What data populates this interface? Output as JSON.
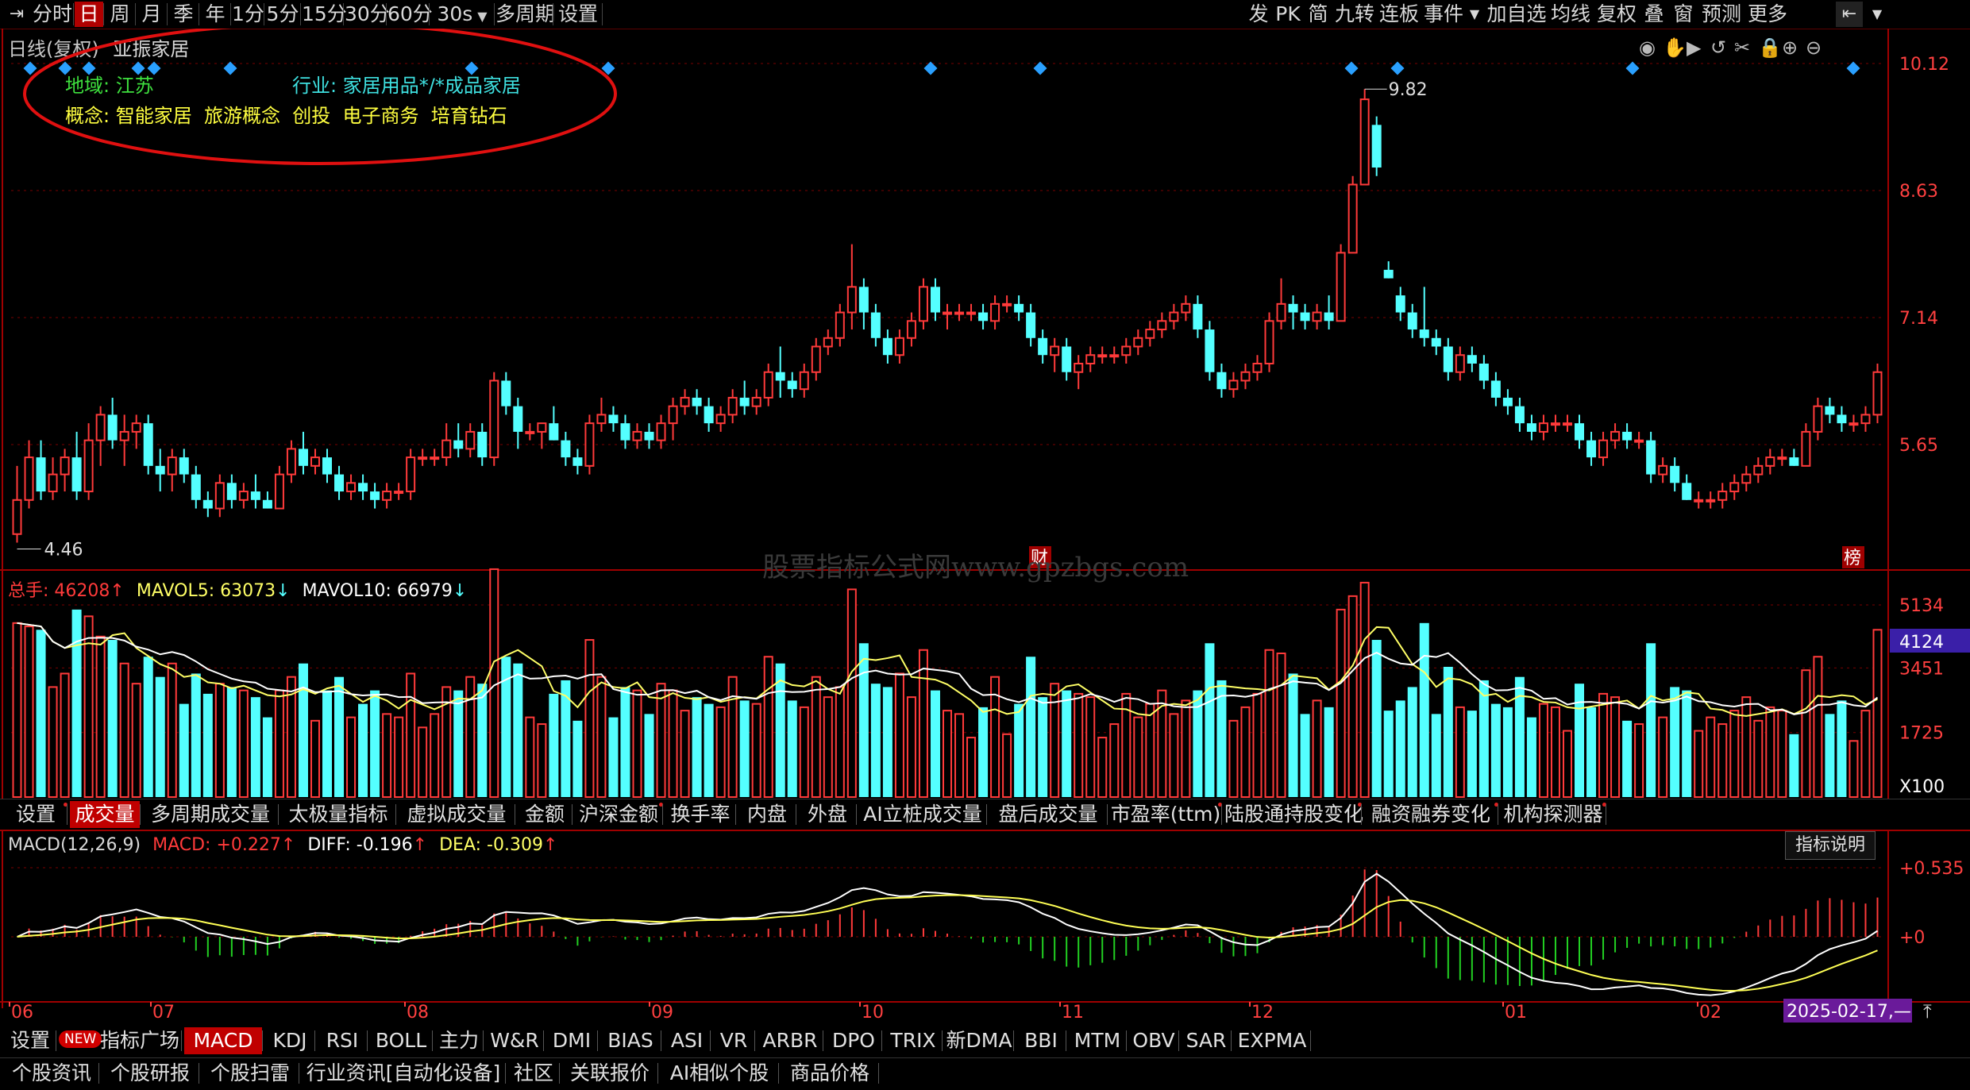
{
  "toolbar": {
    "left_items": [
      "分时",
      "日",
      "周",
      "月",
      "季",
      "年",
      "1分",
      "5分",
      "15分",
      "30分",
      "60分",
      "30s",
      "多周期",
      "设置"
    ],
    "active_index": 1,
    "right_items": [
      "发",
      "PK",
      "简",
      "九转",
      "连板",
      "事件",
      "加自选",
      "均线",
      "复权",
      "叠",
      "窗",
      "预测",
      "更多"
    ]
  },
  "header": {
    "title": "日线(复权)",
    "stock_name": "亚振家居"
  },
  "info_box": {
    "region_label": "地域",
    "region_value": "江苏",
    "industry_label": "行业",
    "industry_value": "家居用品*/*成品家居",
    "concept_label": "概念",
    "concepts": [
      "智能家居",
      "旅游概念",
      "创投",
      "电子商务",
      "培育钻石"
    ]
  },
  "chart_data": {
    "type": "candlestick",
    "price_axis_ticks": [
      "10.12",
      "8.63",
      "7.14",
      "5.65"
    ],
    "high_label": "9.82",
    "low_label": "4.46",
    "markers": [
      "财",
      "榜"
    ],
    "watermark": "股票指标公式网www.gpzbgs.com",
    "x_months": [
      "06",
      "07",
      "08",
      "09",
      "10",
      "11",
      "12",
      "01",
      "02"
    ],
    "last_date": "2025-02-17,—",
    "candles": [
      [
        4.6,
        5.4,
        4.5,
        5.0
      ],
      [
        5.0,
        5.7,
        4.9,
        5.5
      ],
      [
        5.5,
        5.7,
        5.0,
        5.1
      ],
      [
        5.1,
        5.5,
        5.0,
        5.3
      ],
      [
        5.3,
        5.6,
        5.1,
        5.5
      ],
      [
        5.5,
        5.8,
        5.0,
        5.1
      ],
      [
        5.1,
        5.9,
        5.0,
        5.7
      ],
      [
        5.7,
        6.1,
        5.4,
        6.0
      ],
      [
        6.0,
        6.2,
        5.6,
        5.7
      ],
      [
        5.7,
        6.0,
        5.4,
        5.8
      ],
      [
        5.8,
        6.0,
        5.6,
        5.9
      ],
      [
        5.9,
        6.0,
        5.3,
        5.4
      ],
      [
        5.4,
        5.6,
        5.1,
        5.3
      ],
      [
        5.3,
        5.6,
        5.1,
        5.5
      ],
      [
        5.5,
        5.6,
        5.2,
        5.3
      ],
      [
        5.3,
        5.4,
        4.9,
        5.0
      ],
      [
        5.0,
        5.1,
        4.8,
        4.9
      ],
      [
        4.9,
        5.3,
        4.8,
        5.2
      ],
      [
        5.2,
        5.3,
        4.9,
        5.0
      ],
      [
        5.0,
        5.2,
        4.9,
        5.1
      ],
      [
        5.1,
        5.3,
        4.9,
        5.0
      ],
      [
        5.0,
        5.1,
        4.9,
        4.9
      ],
      [
        4.9,
        5.4,
        4.9,
        5.3
      ],
      [
        5.3,
        5.7,
        5.2,
        5.6
      ],
      [
        5.6,
        5.8,
        5.3,
        5.4
      ],
      [
        5.4,
        5.6,
        5.3,
        5.5
      ],
      [
        5.5,
        5.6,
        5.2,
        5.3
      ],
      [
        5.3,
        5.4,
        5.0,
        5.1
      ],
      [
        5.1,
        5.3,
        5.0,
        5.2
      ],
      [
        5.2,
        5.3,
        5.0,
        5.1
      ],
      [
        5.1,
        5.2,
        4.9,
        5.0
      ],
      [
        5.0,
        5.2,
        4.9,
        5.1
      ],
      [
        5.1,
        5.2,
        5.0,
        5.1
      ],
      [
        5.1,
        5.6,
        5.0,
        5.5
      ],
      [
        5.5,
        5.6,
        5.4,
        5.5
      ],
      [
        5.5,
        5.6,
        5.4,
        5.5
      ],
      [
        5.5,
        5.9,
        5.4,
        5.7
      ],
      [
        5.7,
        5.9,
        5.5,
        5.6
      ],
      [
        5.6,
        5.9,
        5.5,
        5.8
      ],
      [
        5.8,
        5.9,
        5.4,
        5.5
      ],
      [
        5.5,
        6.5,
        5.4,
        6.4
      ],
      [
        6.4,
        6.5,
        6.0,
        6.1
      ],
      [
        6.1,
        6.2,
        5.6,
        5.8
      ],
      [
        5.8,
        5.9,
        5.7,
        5.8
      ],
      [
        5.8,
        5.9,
        5.6,
        5.9
      ],
      [
        5.9,
        6.1,
        5.7,
        5.7
      ],
      [
        5.7,
        5.8,
        5.4,
        5.5
      ],
      [
        5.5,
        5.6,
        5.3,
        5.4
      ],
      [
        5.4,
        6.0,
        5.3,
        5.9
      ],
      [
        5.9,
        6.2,
        5.8,
        6.0
      ],
      [
        6.0,
        6.1,
        5.8,
        5.9
      ],
      [
        5.9,
        6.0,
        5.6,
        5.7
      ],
      [
        5.7,
        5.9,
        5.6,
        5.8
      ],
      [
        5.8,
        5.9,
        5.6,
        5.7
      ],
      [
        5.7,
        6.0,
        5.6,
        5.9
      ],
      [
        5.9,
        6.2,
        5.7,
        6.1
      ],
      [
        6.1,
        6.3,
        6.0,
        6.2
      ],
      [
        6.2,
        6.3,
        6.0,
        6.1
      ],
      [
        6.1,
        6.2,
        5.8,
        5.9
      ],
      [
        5.9,
        6.1,
        5.8,
        6.0
      ],
      [
        6.0,
        6.3,
        5.9,
        6.2
      ],
      [
        6.2,
        6.4,
        6.0,
        6.1
      ],
      [
        6.1,
        6.3,
        6.0,
        6.2
      ],
      [
        6.2,
        6.6,
        6.1,
        6.5
      ],
      [
        6.5,
        6.8,
        6.2,
        6.4
      ],
      [
        6.4,
        6.5,
        6.2,
        6.3
      ],
      [
        6.3,
        6.6,
        6.2,
        6.5
      ],
      [
        6.5,
        6.9,
        6.4,
        6.8
      ],
      [
        6.8,
        7.0,
        6.7,
        6.9
      ],
      [
        6.9,
        7.3,
        6.8,
        7.2
      ],
      [
        7.2,
        8.0,
        7.0,
        7.5
      ],
      [
        7.5,
        7.6,
        7.0,
        7.2
      ],
      [
        7.2,
        7.3,
        6.8,
        6.9
      ],
      [
        6.9,
        7.0,
        6.6,
        6.7
      ],
      [
        6.7,
        7.0,
        6.6,
        6.9
      ],
      [
        6.9,
        7.2,
        6.8,
        7.1
      ],
      [
        7.1,
        7.6,
        7.0,
        7.5
      ],
      [
        7.5,
        7.6,
        7.1,
        7.2
      ],
      [
        7.2,
        7.3,
        7.0,
        7.2
      ],
      [
        7.2,
        7.3,
        7.1,
        7.2
      ],
      [
        7.2,
        7.3,
        7.1,
        7.2
      ],
      [
        7.2,
        7.3,
        7.0,
        7.1
      ],
      [
        7.1,
        7.4,
        7.0,
        7.3
      ],
      [
        7.3,
        7.4,
        7.2,
        7.3
      ],
      [
        7.3,
        7.4,
        7.1,
        7.2
      ],
      [
        7.2,
        7.3,
        6.8,
        6.9
      ],
      [
        6.9,
        7.0,
        6.6,
        6.7
      ],
      [
        6.7,
        6.9,
        6.5,
        6.8
      ],
      [
        6.8,
        6.9,
        6.4,
        6.5
      ],
      [
        6.5,
        6.7,
        6.3,
        6.6
      ],
      [
        6.6,
        6.8,
        6.5,
        6.7
      ],
      [
        6.7,
        6.8,
        6.6,
        6.7
      ],
      [
        6.7,
        6.8,
        6.6,
        6.7
      ],
      [
        6.7,
        6.9,
        6.6,
        6.8
      ],
      [
        6.8,
        7.0,
        6.7,
        6.9
      ],
      [
        6.9,
        7.1,
        6.8,
        7.0
      ],
      [
        7.0,
        7.2,
        6.9,
        7.1
      ],
      [
        7.1,
        7.3,
        7.0,
        7.2
      ],
      [
        7.2,
        7.4,
        7.1,
        7.3
      ],
      [
        7.3,
        7.4,
        6.9,
        7.0
      ],
      [
        7.0,
        7.1,
        6.4,
        6.5
      ],
      [
        6.5,
        6.6,
        6.2,
        6.3
      ],
      [
        6.3,
        6.5,
        6.2,
        6.4
      ],
      [
        6.4,
        6.6,
        6.3,
        6.5
      ],
      [
        6.5,
        6.7,
        6.4,
        6.6
      ],
      [
        6.6,
        7.2,
        6.5,
        7.1
      ],
      [
        7.1,
        7.6,
        7.0,
        7.3
      ],
      [
        7.3,
        7.4,
        7.0,
        7.2
      ],
      [
        7.2,
        7.3,
        7.0,
        7.1
      ],
      [
        7.1,
        7.3,
        7.0,
        7.2
      ],
      [
        7.2,
        7.4,
        7.0,
        7.1
      ],
      [
        7.1,
        8.0,
        7.1,
        7.9
      ],
      [
        7.9,
        8.8,
        7.9,
        8.7
      ],
      [
        8.7,
        9.82,
        8.7,
        9.7
      ],
      [
        9.4,
        9.5,
        8.8,
        8.9
      ],
      [
        7.7,
        7.8,
        7.6,
        7.6
      ],
      [
        7.4,
        7.5,
        7.1,
        7.2
      ],
      [
        7.2,
        7.3,
        6.9,
        7.0
      ],
      [
        7.0,
        7.5,
        6.8,
        6.9
      ],
      [
        6.9,
        7.0,
        6.7,
        6.8
      ],
      [
        6.8,
        6.9,
        6.4,
        6.5
      ],
      [
        6.5,
        6.8,
        6.4,
        6.7
      ],
      [
        6.7,
        6.8,
        6.5,
        6.6
      ],
      [
        6.6,
        6.7,
        6.3,
        6.4
      ],
      [
        6.4,
        6.5,
        6.1,
        6.2
      ],
      [
        6.2,
        6.3,
        6.0,
        6.1
      ],
      [
        6.1,
        6.2,
        5.8,
        5.9
      ],
      [
        5.9,
        6.0,
        5.7,
        5.8
      ],
      [
        5.8,
        6.0,
        5.7,
        5.9
      ],
      [
        5.9,
        6.0,
        5.8,
        5.9
      ],
      [
        5.9,
        6.0,
        5.8,
        5.9
      ],
      [
        5.9,
        6.0,
        5.6,
        5.7
      ],
      [
        5.7,
        5.8,
        5.4,
        5.5
      ],
      [
        5.5,
        5.8,
        5.4,
        5.7
      ],
      [
        5.7,
        5.9,
        5.6,
        5.8
      ],
      [
        5.8,
        5.9,
        5.6,
        5.7
      ],
      [
        5.7,
        5.8,
        5.6,
        5.7
      ],
      [
        5.7,
        5.8,
        5.2,
        5.3
      ],
      [
        5.3,
        5.5,
        5.2,
        5.4
      ],
      [
        5.4,
        5.5,
        5.1,
        5.2
      ],
      [
        5.2,
        5.3,
        5.0,
        5.0
      ],
      [
        5.0,
        5.1,
        4.9,
        5.0
      ],
      [
        5.0,
        5.1,
        4.9,
        5.0
      ],
      [
        5.0,
        5.2,
        4.9,
        5.1
      ],
      [
        5.1,
        5.3,
        5.0,
        5.2
      ],
      [
        5.2,
        5.4,
        5.1,
        5.3
      ],
      [
        5.3,
        5.5,
        5.2,
        5.4
      ],
      [
        5.4,
        5.6,
        5.3,
        5.5
      ],
      [
        5.5,
        5.6,
        5.4,
        5.5
      ],
      [
        5.5,
        5.6,
        5.4,
        5.4
      ],
      [
        5.4,
        5.9,
        5.4,
        5.8
      ],
      [
        5.8,
        6.2,
        5.7,
        6.1
      ],
      [
        6.1,
        6.2,
        5.9,
        6.0
      ],
      [
        6.0,
        6.1,
        5.8,
        5.9
      ],
      [
        5.9,
        6.0,
        5.8,
        5.9
      ],
      [
        5.9,
        6.1,
        5.8,
        6.0
      ],
      [
        6.0,
        6.6,
        5.9,
        6.5
      ]
    ],
    "volume": {
      "label": "总手",
      "value": "46208",
      "mavol5_label": "MAVOL5",
      "mavol5": "63073",
      "mavol10_label": "MAVOL10",
      "mavol10": "66979",
      "ticks": [
        "5134",
        "3451",
        "1725"
      ],
      "highlight_tick": "4124",
      "unit": "X100"
    },
    "macd": {
      "label": "MACD(12,26,9)",
      "macd_label": "MACD",
      "macd_value": "+0.227",
      "diff_label": "DIFF",
      "diff_value": "-0.196",
      "dea_label": "DEA",
      "dea_value": "-0.309",
      "ticks": [
        "+0.535",
        "+0"
      ],
      "help_button": "指标说明"
    }
  },
  "indicator_tabs_1": [
    "设置",
    "成交量",
    "多周期成交量",
    "太极量指标",
    "虚拟成交量",
    "金额",
    "沪深金额",
    "换手率",
    "内盘",
    "外盘",
    "AI立桩成交量",
    "盘后成交量",
    "市盈率(ttm)",
    "陆股通持股变化",
    "融资融券变化",
    "机构探测器"
  ],
  "indicator_tabs_2": [
    "设置",
    "指标广场",
    "MACD",
    "KDJ",
    "RSI",
    "BOLL",
    "主力",
    "W&R",
    "DMI",
    "BIAS",
    "ASI",
    "VR",
    "ARBR",
    "DPO",
    "TRIX",
    "新DMA",
    "BBI",
    "MTM",
    "OBV",
    "SAR",
    "EXPMA"
  ],
  "new_badge": "NEW",
  "info_tabs": [
    "个股资讯",
    "个股研报",
    "个股扫雷",
    "行业资讯[自动化设备]",
    "社区",
    "关联报价",
    "AI相似个股",
    "商品价格"
  ],
  "colors": {
    "up": "#ff3a3a",
    "down": "#54ffff",
    "ma5": "#ffff66",
    "ma10": "#ffffff",
    "accent": "#c00000",
    "grid": "#7a0000"
  }
}
